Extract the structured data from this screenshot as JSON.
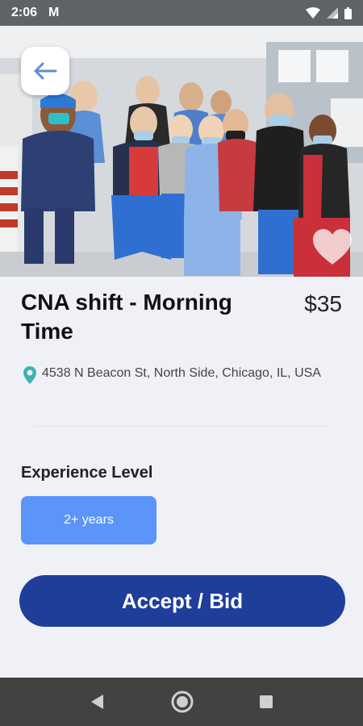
{
  "status_bar": {
    "time": "2:06",
    "notification_glyph": "M",
    "icons": [
      "wifi-icon",
      "signal-icon",
      "battery-icon"
    ]
  },
  "hero": {
    "image_icon": "group-photo",
    "back_icon": "arrow-left-icon",
    "favorite_icon": "heart-icon"
  },
  "shift": {
    "title": "CNA shift - Morning Time",
    "price": "$35",
    "location_icon": "map-pin-icon",
    "address": "4538 N Beacon St, North Side, Chicago, IL, USA"
  },
  "experience": {
    "label": "Experience Level",
    "value": "2+ years"
  },
  "actions": {
    "accept_label": "Accept / Bid"
  },
  "nav": {
    "icons": [
      "back-triangle-icon",
      "home-circle-icon",
      "recents-square-icon"
    ]
  },
  "colors": {
    "primary": "#1f3e9a",
    "chip": "#5b95f9",
    "pin": "#3fb3b0"
  }
}
